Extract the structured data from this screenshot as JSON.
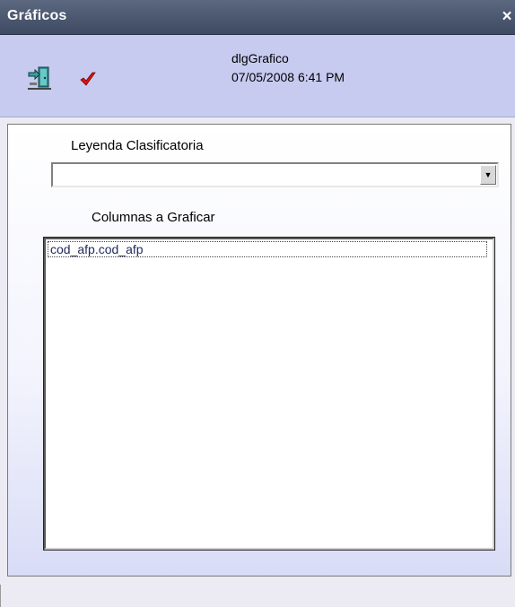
{
  "window": {
    "title": "Gráficos",
    "close_glyph": "×"
  },
  "header": {
    "dialog_name": "dlgGrafico",
    "datetime": "07/05/2008 6:41 PM",
    "icons": [
      "exit-door-icon",
      "red-check-icon"
    ]
  },
  "form": {
    "legend_label": "Leyenda Clasificatoria",
    "legend_value": "",
    "columns_label": "Columnas a Graficar",
    "columns_items": [
      "cod_afp.cod_afp"
    ]
  },
  "colors": {
    "titlebar": "#46536b",
    "header_bg": "#c7cbf0",
    "list_text": "#1e2a5e"
  }
}
